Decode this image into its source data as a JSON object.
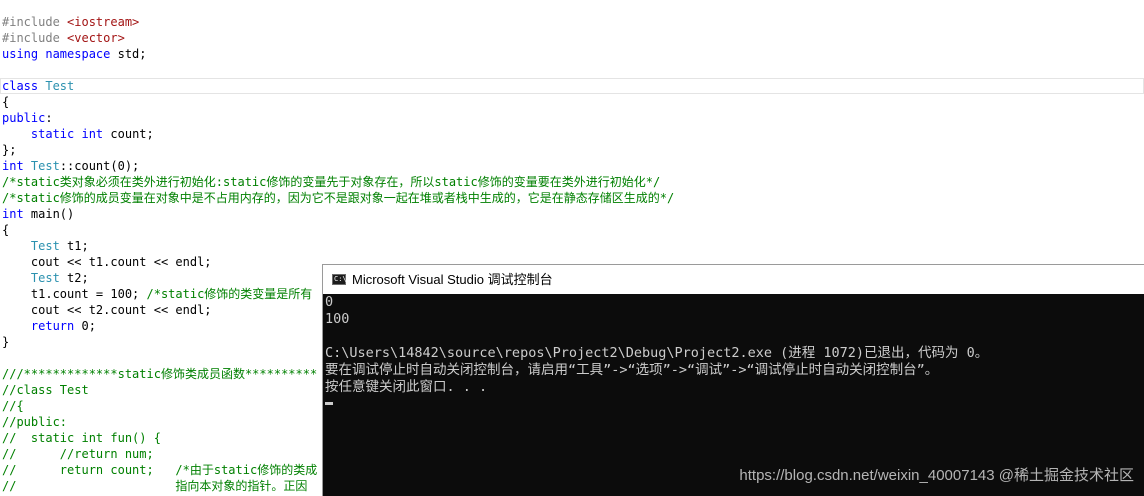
{
  "editor": {
    "lines": [
      {
        "parts": [
          {
            "t": "#include ",
            "c": "inc"
          },
          {
            "t": "<iostream>",
            "c": "str"
          }
        ]
      },
      {
        "parts": [
          {
            "t": "#include ",
            "c": "inc"
          },
          {
            "t": "<vector>",
            "c": "str"
          }
        ]
      },
      {
        "parts": [
          {
            "t": "using namespace ",
            "c": "kw"
          },
          {
            "t": "std;",
            "c": ""
          }
        ]
      },
      {
        "parts": []
      },
      {
        "parts": [
          {
            "t": "class ",
            "c": "kw"
          },
          {
            "t": "Test",
            "c": "type"
          }
        ]
      },
      {
        "parts": [
          {
            "t": "{",
            "c": ""
          }
        ]
      },
      {
        "parts": [
          {
            "t": "public",
            "c": "kw"
          },
          {
            "t": ":",
            "c": ""
          }
        ]
      },
      {
        "parts": [
          {
            "t": "    ",
            "c": ""
          },
          {
            "t": "static int ",
            "c": "kw"
          },
          {
            "t": "count;",
            "c": ""
          }
        ]
      },
      {
        "parts": [
          {
            "t": "};",
            "c": ""
          }
        ]
      },
      {
        "parts": [
          {
            "t": "int ",
            "c": "kw"
          },
          {
            "t": "Test",
            "c": "type"
          },
          {
            "t": "::count(0);",
            "c": ""
          }
        ]
      },
      {
        "parts": [
          {
            "t": "/*static类对象必须在类外进行初始化:static修饰的变量先于对象存在，所以static修饰的变量要在类外进行初始化*/",
            "c": "cm"
          }
        ]
      },
      {
        "parts": [
          {
            "t": "/*static修饰的成员变量在对象中是不占用内存的，因为它不是跟对象一起在堆或者栈中生成的，它是在静态存储区生成的*/",
            "c": "cm"
          }
        ]
      },
      {
        "parts": [
          {
            "t": "int ",
            "c": "kw"
          },
          {
            "t": "main()",
            "c": ""
          }
        ]
      },
      {
        "parts": [
          {
            "t": "{",
            "c": ""
          }
        ]
      },
      {
        "parts": [
          {
            "t": "    ",
            "c": ""
          },
          {
            "t": "Test",
            "c": "type"
          },
          {
            "t": " t1;",
            "c": ""
          }
        ]
      },
      {
        "parts": [
          {
            "t": "    cout << t1.count << endl;",
            "c": ""
          }
        ]
      },
      {
        "parts": [
          {
            "t": "    ",
            "c": ""
          },
          {
            "t": "Test",
            "c": "type"
          },
          {
            "t": " t2;",
            "c": ""
          }
        ]
      },
      {
        "parts": [
          {
            "t": "    t1.count = 100; ",
            "c": ""
          },
          {
            "t": "/*static修饰的类变量是所有",
            "c": "cm"
          }
        ]
      },
      {
        "parts": [
          {
            "t": "    cout << t2.count << endl;",
            "c": ""
          }
        ]
      },
      {
        "parts": [
          {
            "t": "    ",
            "c": ""
          },
          {
            "t": "return ",
            "c": "kw"
          },
          {
            "t": "0;",
            "c": ""
          }
        ]
      },
      {
        "parts": [
          {
            "t": "}",
            "c": ""
          }
        ]
      },
      {
        "parts": []
      },
      {
        "parts": [
          {
            "t": "///*************static修饰类成员函数**********",
            "c": "cm"
          }
        ]
      },
      {
        "parts": [
          {
            "t": "//class Test",
            "c": "cm"
          }
        ]
      },
      {
        "parts": [
          {
            "t": "//{",
            "c": "cm"
          }
        ]
      },
      {
        "parts": [
          {
            "t": "//public:",
            "c": "cm"
          }
        ]
      },
      {
        "parts": [
          {
            "t": "//  static int fun() {",
            "c": "cm"
          }
        ]
      },
      {
        "parts": [
          {
            "t": "//      //return num;",
            "c": "cm"
          }
        ]
      },
      {
        "parts": [
          {
            "t": "//      return count;   /*由于static修饰的类成",
            "c": "cm"
          }
        ]
      },
      {
        "parts": [
          {
            "t": "//                      指向本对象的指针。正因",
            "c": "cm"
          }
        ]
      }
    ]
  },
  "console": {
    "title": "Microsoft Visual Studio 调试控制台",
    "icon_glyph": "C:\\",
    "lines": [
      "0",
      "100",
      "",
      "C:\\Users\\14842\\source\\repos\\Project2\\Debug\\Project2.exe (进程 1072)已退出，代码为 0。",
      "要在调试停止时自动关闭控制台，请启用“工具”->“选项”->“调试”->“调试停止时自动关闭控制台”。",
      "按任意键关闭此窗口. . ."
    ]
  },
  "watermark": "https://blog.csdn.net/weixin_40007143 @稀土掘金技术社区"
}
